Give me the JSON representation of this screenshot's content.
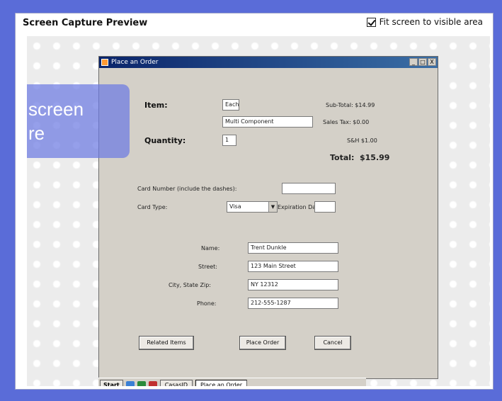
{
  "panel": {
    "title": "Screen Capture Preview",
    "fit_label": "Fit screen to visible area",
    "fit_checked": true
  },
  "overlay": {
    "line1": "screen",
    "line2": "re"
  },
  "window": {
    "title": "Place an Order",
    "min": "_",
    "max": "□",
    "close": "X"
  },
  "order": {
    "item_label": "Item:",
    "item_value": "Each",
    "item_desc": "Multi Component",
    "subtotal": "Sub-Total: $14.99",
    "sales_tax": "Sales Tax: $0.00",
    "quantity_label": "Quantity:",
    "quantity_value": "1",
    "shipping": "S&H $1.00",
    "total_label": "Total:",
    "total_value": "$15.99"
  },
  "payment": {
    "card_number_label": "Card Number (include the dashes):",
    "card_number_value": "",
    "card_type_label": "Card Type:",
    "card_type_value": "Visa",
    "expiration_label": "Expiration Date:",
    "expiration_value": ""
  },
  "customer": {
    "name_label": "Name:",
    "name_value": "Trent Dunkle",
    "street_label": "Street:",
    "street_value": "123 Main Street",
    "city_label": "City, State Zip:",
    "city_value": "NY 12312",
    "phone_label": "Phone:",
    "phone_value": "212-555-1287"
  },
  "buttons": {
    "related": "Related Items",
    "place": "Place Order",
    "cancel": "Cancel"
  },
  "taskbar": {
    "start": "Start",
    "task1": "CasasID",
    "task2": "Place an Order"
  }
}
